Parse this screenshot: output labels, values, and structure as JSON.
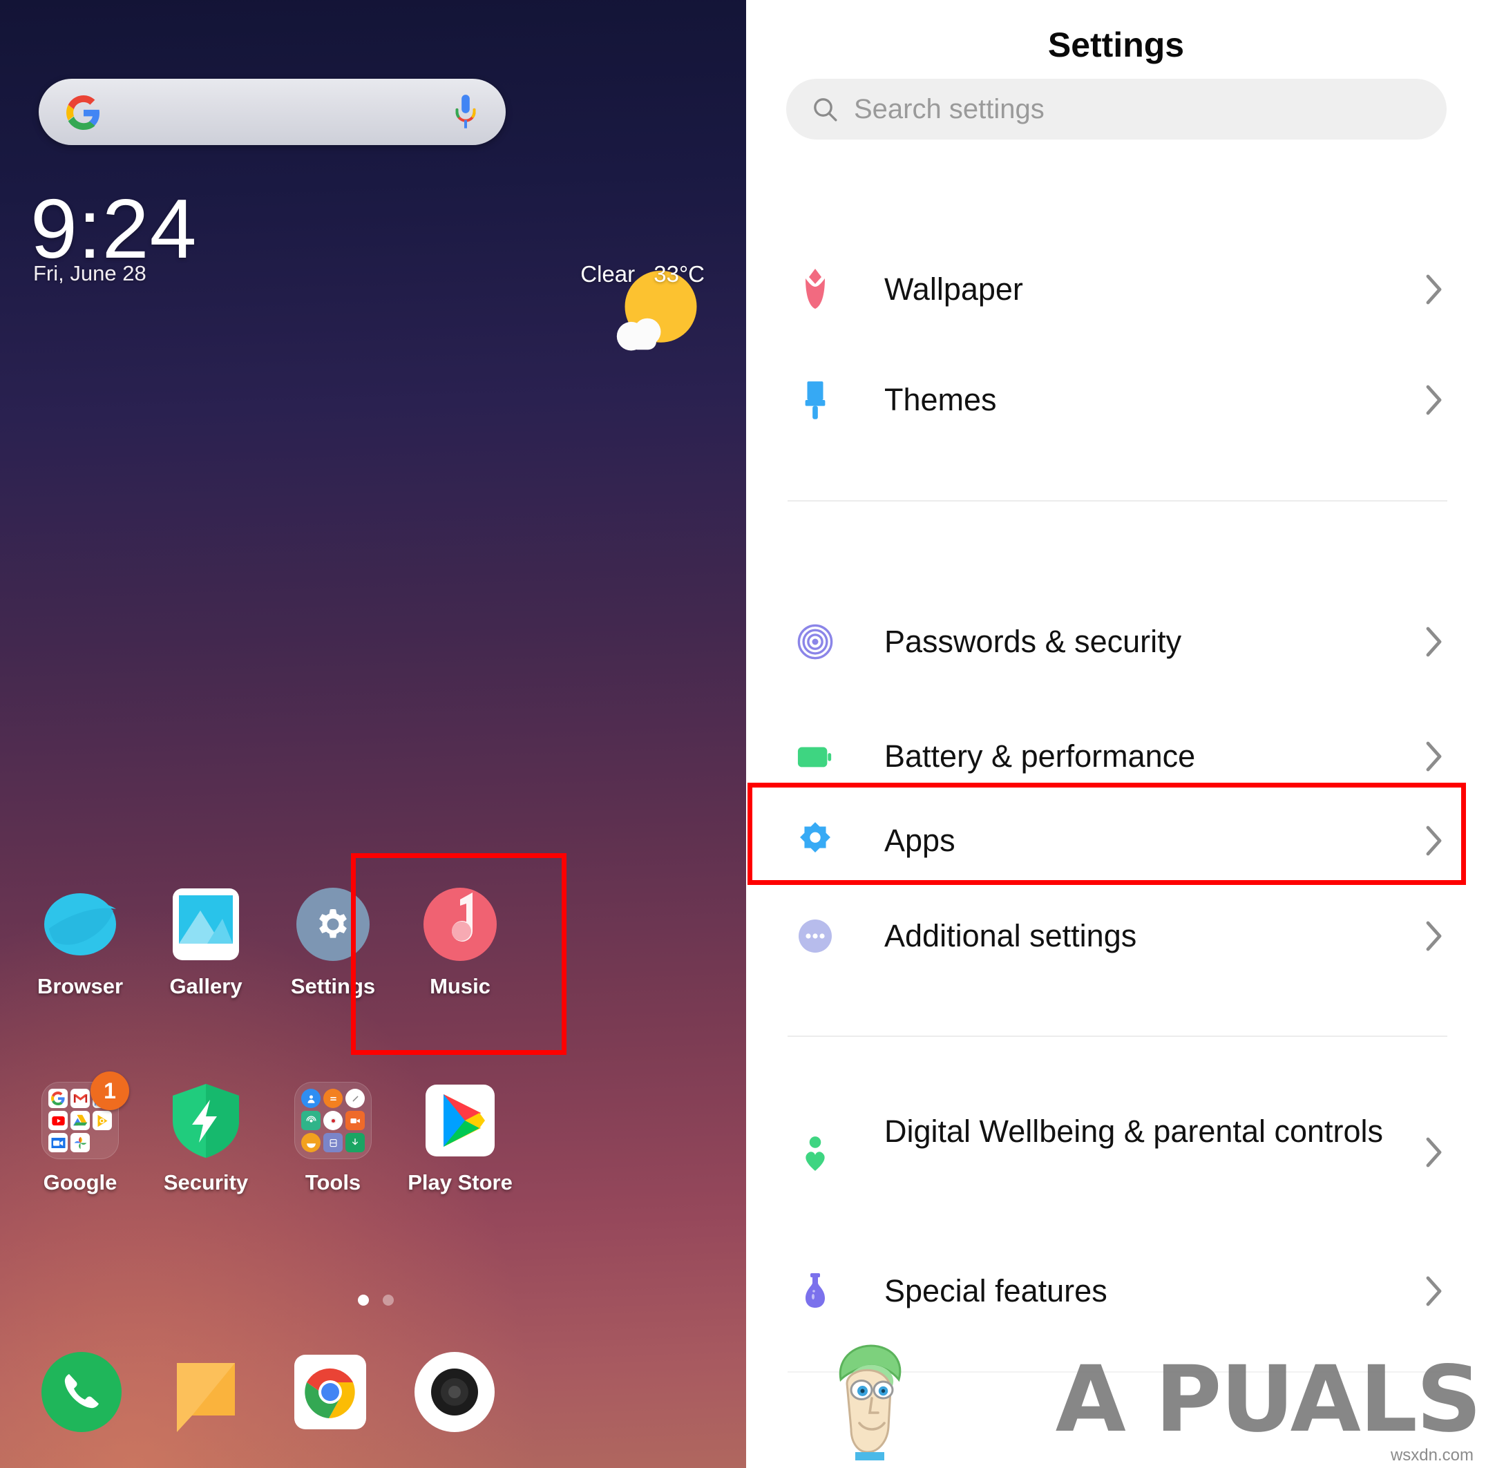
{
  "home": {
    "search_widget": {
      "google_icon": "google-g-icon",
      "mic_icon": "microphone-icon",
      "placeholder": ""
    },
    "clock": {
      "time": "9:24",
      "date": "Fri, June 28"
    },
    "weather": {
      "condition": "Clear",
      "temperature": "33°C",
      "icon": "sun-behind-cloud-icon"
    },
    "apps_row1": [
      {
        "label": "Browser",
        "icon": "browser-icon"
      },
      {
        "label": "Gallery",
        "icon": "gallery-icon"
      },
      {
        "label": "Settings",
        "icon": "settings-gear-icon",
        "highlighted": true
      },
      {
        "label": "Music",
        "icon": "music-note-icon"
      }
    ],
    "apps_row2": [
      {
        "label": "Google",
        "icon": "google-folder-icon",
        "badge": "1"
      },
      {
        "label": "Security",
        "icon": "security-shield-icon"
      },
      {
        "label": "Tools",
        "icon": "tools-folder-icon"
      },
      {
        "label": "Play Store",
        "icon": "play-store-icon"
      }
    ],
    "page_indicator": {
      "pages": 2,
      "active": 1
    },
    "dock": [
      {
        "label": "Phone",
        "icon": "phone-icon"
      },
      {
        "label": "Messages",
        "icon": "messages-icon"
      },
      {
        "label": "Chrome",
        "icon": "chrome-icon"
      },
      {
        "label": "Camera",
        "icon": "camera-icon"
      }
    ]
  },
  "settings": {
    "title": "Settings",
    "search": {
      "placeholder": "Search settings",
      "icon": "search-icon"
    },
    "groups": [
      {
        "items": [
          {
            "label": "Wallpaper",
            "icon": "tulip-flower-icon",
            "color": "#f26a80"
          },
          {
            "label": "Themes",
            "icon": "paint-brush-icon",
            "color": "#36a9f4"
          }
        ]
      },
      {
        "items": [
          {
            "label": "Passwords & security",
            "icon": "fingerprint-icon",
            "color": "#8b85e8"
          },
          {
            "label": "Battery & performance",
            "icon": "battery-icon",
            "color": "#3ed581"
          },
          {
            "label": "Apps",
            "icon": "apps-gear-icon",
            "color": "#37aaf5",
            "highlighted": true
          },
          {
            "label": "Additional settings",
            "icon": "more-dots-icon",
            "color": "#b7bcec"
          }
        ]
      },
      {
        "items": [
          {
            "label": "Digital Wellbeing & parental controls",
            "icon": "wellbeing-person-heart-icon",
            "color": "#3ed581"
          },
          {
            "label": "Special features",
            "icon": "flask-icon",
            "color": "#7b71ec"
          }
        ]
      }
    ],
    "chevron_icon": "chevron-right-icon"
  },
  "watermark": {
    "brand": "A  PUALS",
    "brand_prefix": "A",
    "brand_suffix": "PUALS",
    "source": "wsxdn.com"
  },
  "annotation": {
    "color": "#fe0000",
    "targets": [
      "settings-app-icon",
      "apps-settings-row"
    ]
  }
}
